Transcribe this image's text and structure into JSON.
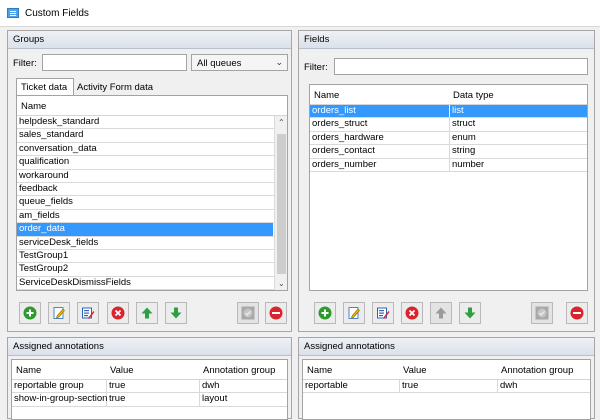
{
  "window": {
    "title": "Custom Fields"
  },
  "groups": {
    "header": "Groups",
    "filter_label": "Filter:",
    "queue_select": "All queues",
    "tabs": [
      {
        "label": "Ticket data"
      },
      {
        "label": "Activity Form data"
      }
    ],
    "column": "Name",
    "items": [
      "helpdesk_standard",
      "sales_standard",
      "conversation_data",
      "qualification",
      "workaround",
      "feedback",
      "queue_fields",
      "am_fields",
      "order_data",
      "serviceDesk_fields",
      "TestGroup1",
      "TestGroup2",
      "ServiceDeskDismissFields"
    ],
    "selected": "order_data"
  },
  "fields": {
    "header": "Fields",
    "filter_label": "Filter:",
    "columns": [
      "Name",
      "Data type"
    ],
    "rows": [
      [
        "orders_list",
        "list"
      ],
      [
        "orders_struct",
        "struct"
      ],
      [
        "orders_hardware",
        "enum"
      ],
      [
        "orders_contact",
        "string"
      ],
      [
        "orders_number",
        "number"
      ]
    ],
    "selected": "orders_list"
  },
  "groups_annotations": {
    "header": "Assigned annotations",
    "columns": [
      "Name",
      "Value",
      "Annotation group"
    ],
    "rows": [
      [
        "reportable group",
        "true",
        "dwh"
      ],
      [
        "show-in-group-section",
        "true",
        "layout"
      ]
    ]
  },
  "fields_annotations": {
    "header": "Assigned annotations",
    "columns": [
      "Name",
      "Value",
      "Annotation group"
    ],
    "rows": [
      [
        "reportable",
        "true",
        "dwh"
      ]
    ]
  },
  "icons": {
    "add": "plus-circle-icon",
    "edit": "pencil-page-icon",
    "edit_fields": "edit-list-icon",
    "remove": "x-circle-icon",
    "up": "arrow-up-icon",
    "down": "arrow-down-icon",
    "apply": "check-circle-icon",
    "delete": "minus-circle-icon"
  },
  "colors": {
    "selection": "#3399ff",
    "add_green": "#2e9a2e",
    "remove_red": "#d9232d",
    "arrow_green": "#2ea043"
  }
}
